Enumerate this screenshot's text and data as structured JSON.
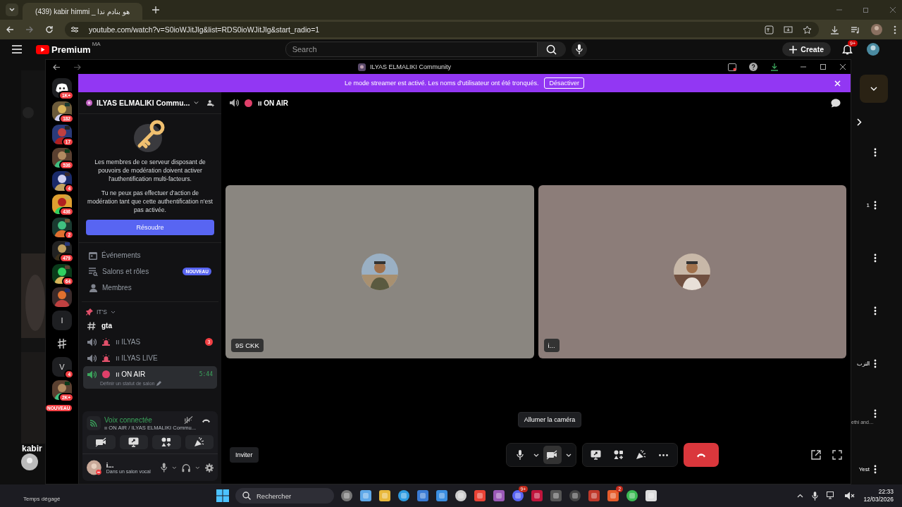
{
  "browser": {
    "tab_title": "(439) kabir himmi _ هو بنادم ندا",
    "url": "youtube.com/watch?v=S0ioWJitJlg&list=RDS0ioWJitJlg&start_radio=1"
  },
  "youtube": {
    "logo": "Premium",
    "region": "MA",
    "search_placeholder": "Search",
    "create": "Create",
    "notifications": "9+",
    "left_text": "kabir",
    "right_texts": [
      {
        "text": "1"
      },
      {
        "text": "الترب"
      },
      {
        "text": "ethi and…"
      },
      {
        "text": "Yest"
      }
    ]
  },
  "discord": {
    "title": "ILYAS ELMALIKI Community",
    "banner": {
      "text": "Le mode streamer est activé. Les noms d'utilisateur ont été tronqués.",
      "button": "Désactiver"
    },
    "servers": [
      {
        "kind": "home",
        "badge": "1K+"
      },
      {
        "kind": "picture",
        "badge": "182"
      },
      {
        "kind": "picture",
        "badge": "17"
      },
      {
        "kind": "picture",
        "badge": "536"
      },
      {
        "kind": "picture",
        "badge": "4"
      },
      {
        "kind": "picture",
        "badge": "436"
      },
      {
        "kind": "picture",
        "badge": "2"
      },
      {
        "kind": "picture",
        "badge": "479"
      },
      {
        "kind": "picture",
        "badge": "64"
      },
      {
        "kind": "picture"
      },
      {
        "kind": "letter",
        "text": "I"
      },
      {
        "kind": "glyph"
      },
      {
        "kind": "letter",
        "text": "V",
        "badge": "4"
      },
      {
        "kind": "picture",
        "badge": "2K+",
        "tag": "NOUVEAU"
      }
    ],
    "server_name": "ILYAS ELMALIKI Commu...",
    "mfa": {
      "text1": "Les membres de ce serveur disposant de pouvoirs de modération doivent activer l'authentification multi-facteurs.",
      "text2": "Tu ne peux pas effectuer d'action de modération tant que cette authentification n'est pas activée.",
      "button": "Résoudre"
    },
    "menu": [
      {
        "kind": "events",
        "label": "Événements"
      },
      {
        "kind": "channels",
        "label": "Salons et rôles",
        "badge": "NOUVEAU"
      },
      {
        "kind": "members",
        "label": "Membres"
      }
    ],
    "category": "IT'S",
    "channels": [
      {
        "kind": "text",
        "name": "gta",
        "selected": false
      },
      {
        "kind": "alert-voice",
        "name": "ıı ILYAS",
        "badge": "3",
        "selected": false
      },
      {
        "kind": "alert-voice",
        "name": "ıı ILYAS LIVE",
        "selected": false
      },
      {
        "kind": "live-voice",
        "name": "ıı ON AIR",
        "timer": "5:44",
        "status": "Définir un statut de salon",
        "selected": true
      }
    ],
    "voice": {
      "status": "Voix connectée",
      "channel": "ıı ON AIR / ILYAS ELMALIKI Commu..."
    },
    "user": {
      "name": "i...",
      "status": "Dans un salon vocal"
    },
    "stage": {
      "channel": "ıı ON AIR",
      "tiles": [
        {
          "label": "9S CKK",
          "color": "#8a8680"
        },
        {
          "label": "i...",
          "color": "#8c7d79"
        }
      ],
      "tooltip": "Allumer la caméra",
      "invite": "Inviter"
    }
  },
  "taskbar": {
    "search_placeholder": "Rechercher",
    "weather": "Temps dégagé",
    "chat_badge": "9+",
    "game_badge": "2",
    "time": "22:33",
    "date": "12/03/2026"
  }
}
